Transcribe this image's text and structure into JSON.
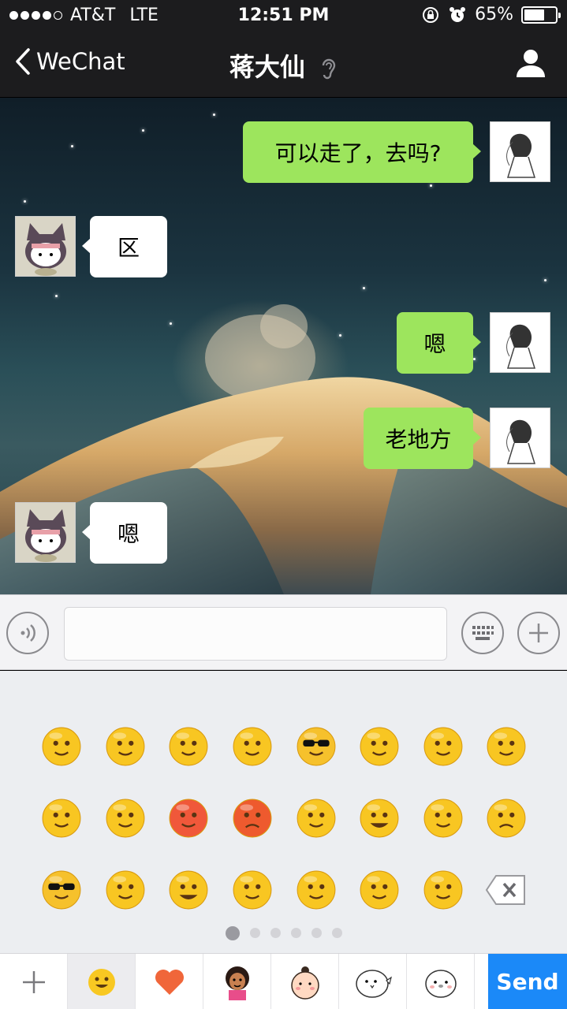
{
  "status_bar": {
    "carrier": "AT&T",
    "network": "LTE",
    "time": "12:51 PM",
    "battery": "65%",
    "battery_level": 0.65,
    "signal_bars_filled": 4,
    "signal_bars_total": 5
  },
  "nav": {
    "back_label": "WeChat",
    "title": "蒋大仙",
    "icons": [
      "chevron-left-icon",
      "ear-icon",
      "profile-icon"
    ]
  },
  "messages": [
    {
      "from": "me",
      "text": "可以走了，去吗?"
    },
    {
      "from": "them",
      "text": "区"
    },
    {
      "from": "me",
      "text": "嗯"
    },
    {
      "from": "me",
      "text": "老地方"
    },
    {
      "from": "them",
      "text": "嗯"
    }
  ],
  "input_bar": {
    "value": "",
    "icons": [
      "voice-icon",
      "keyboard-icon",
      "plus-icon"
    ]
  },
  "emoji_panel": {
    "emojis": [
      "smile",
      "awkward",
      "heart-eyes",
      "shocked",
      "cool-sunglasses",
      "crying-loudly",
      "blush-angry",
      "shush",
      "sleepy-sigh",
      "tears-squint",
      "red-blush",
      "angry",
      "tongue-wink",
      "grin",
      "surprised-blush",
      "sad",
      "tough-sunglasses",
      "shy",
      "screaming",
      "drooling",
      "facepalm-giggle",
      "happy-blush",
      "startled",
      "backspace"
    ],
    "page_count": 6,
    "active_page": 1
  },
  "tab_bar": {
    "tabs": [
      "add-icon",
      "emoji-icon",
      "heart-icon",
      "sticker-girl-icon",
      "sticker-bun-icon",
      "sticker-bird-icon",
      "sticker-chick-icon"
    ],
    "selected_tab": "emoji-icon",
    "send_label": "Send"
  },
  "colors": {
    "outgoing_bubble": "#9de55d",
    "incoming_bubble": "#ffffff",
    "send_button": "#1b89f8",
    "nav_background": "#1c1c1e"
  }
}
